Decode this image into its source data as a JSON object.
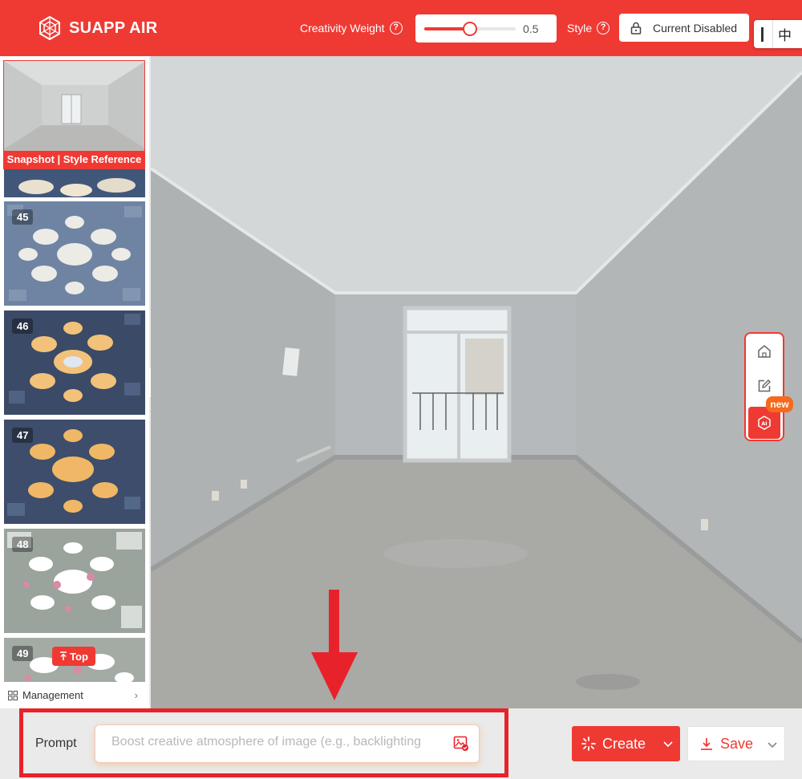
{
  "header": {
    "app_name": "SUAPP AIR",
    "creativity_weight_label": "Creativity Weight",
    "creativity_weight_value": "0.5",
    "creativity_weight_fraction": 0.5,
    "style_label": "Style",
    "style_value": "Current Disabled",
    "language_toggle": "中",
    "accent_color": "#ef3a33"
  },
  "sidebar": {
    "snapshot_caption": "Snapshot | Style Reference",
    "thumbnails": [
      {
        "number": "45"
      },
      {
        "number": "46"
      },
      {
        "number": "47"
      },
      {
        "number": "48"
      },
      {
        "number": "49"
      }
    ],
    "top_button_label": "Top",
    "management_label": "Management"
  },
  "floating_tools": {
    "items": [
      "home-icon",
      "edit-icon",
      "ai-cube-icon"
    ],
    "new_badge": "new"
  },
  "bottom": {
    "prompt_label": "Prompt",
    "prompt_placeholder": "Boost creative atmosphere of image (e.g., backlighting",
    "prompt_value": "",
    "create_label": "Create",
    "save_label": "Save"
  }
}
